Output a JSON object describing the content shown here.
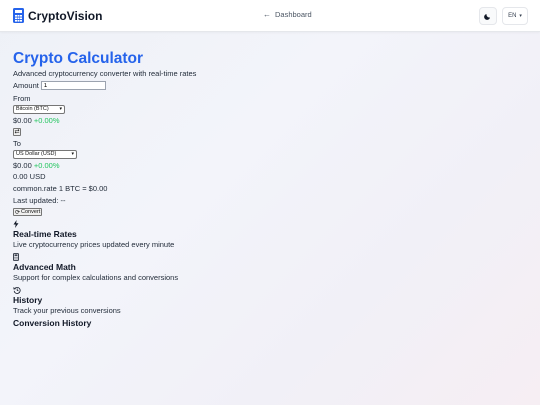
{
  "header": {
    "brand": "CryptoVision",
    "nav_link": "Dashboard",
    "language": "EN",
    "theme_icon": "moon-icon"
  },
  "calculator": {
    "title": "Crypto Calculator",
    "subtitle": "Advanced cryptocurrency converter with real-time rates",
    "amount_label": "Amount",
    "amount_value": "1",
    "from_label": "From",
    "from_selected": "Bitcoin (BTC)",
    "from_price": "$0.00",
    "from_change": "+0.00%",
    "swap_icon": "swap-arrows-icon",
    "to_label": "To",
    "to_selected": "US Dollar (USD)",
    "to_price": "$0.00",
    "to_change": "+0.00%",
    "result": "0.00 USD",
    "rate_text": "common.rate 1 BTC = $0.00",
    "last_updated": "Last updated: --",
    "convert_label": "Convert"
  },
  "features": [
    {
      "icon": "lightning-icon",
      "title": "Real-time Rates",
      "desc": "Live cryptocurrency prices updated every minute"
    },
    {
      "icon": "calculator-icon",
      "title": "Advanced Math",
      "desc": "Support for complex calculations and conversions"
    },
    {
      "icon": "history-icon",
      "title": "History",
      "desc": "Track your previous conversions"
    }
  ],
  "history_heading": "Conversion History",
  "colors": {
    "accent": "#2563eb",
    "positive": "#22c55e"
  }
}
